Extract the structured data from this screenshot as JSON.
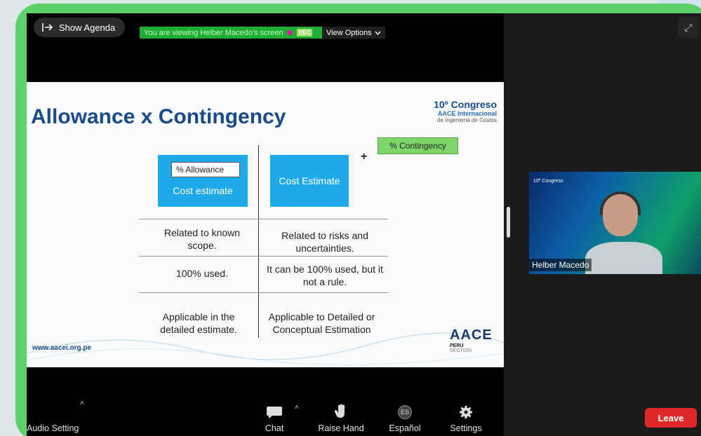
{
  "top_bar": {
    "agenda_label": "Show Agenda",
    "viewing_text": "You are viewing Helber Macedo's screen",
    "rec_label": "REC",
    "view_options_label": "View Options"
  },
  "slide": {
    "title": "Allowance x Contingency",
    "congreso_line1": "10º Congreso",
    "congreso_line2": "AACE Internacional",
    "congreso_line3": "de Ingeniería de Costos",
    "allowance_label": "% Allowance",
    "cost_estimate_left": "Cost estimate",
    "cost_estimate_right": "Cost Estimate",
    "plus": "+",
    "contingency_label": "% Contingency",
    "rows": [
      {
        "left": "Related to known scope.",
        "right": "Related to risks and uncertainties."
      },
      {
        "left": "100% used.",
        "right": "It can be 100% used, but it not a rule."
      },
      {
        "left": "Applicable in the detailed estimate.",
        "right": "Applicable to Detailed or Conceptual Estimation"
      }
    ],
    "url": "www.aacei.org.pe",
    "aace_logo": "AACE",
    "aace_peru": "PERU",
    "aace_section": "SECTION"
  },
  "video": {
    "participant_name": "Helber Macedo"
  },
  "toolbar": {
    "audio_label": "Audio Setting",
    "chat_label": "Chat",
    "raise_hand_label": "Raise Hand",
    "language_label": "Español",
    "language_badge": "ES",
    "settings_label": "Settings",
    "leave_label": "Leave"
  }
}
